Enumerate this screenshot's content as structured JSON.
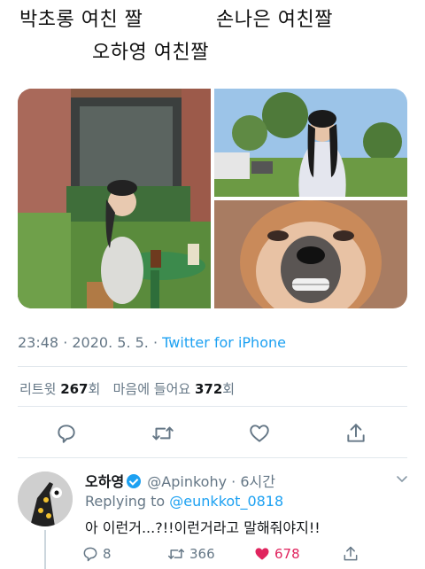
{
  "caption": {
    "line1": "박초롱 여친 짤",
    "line2": "손나은 여친짤",
    "line3": "오하영 여친짤"
  },
  "tweet": {
    "time": "23:48",
    "date": "2020. 5. 5.",
    "source": "Twitter for iPhone",
    "retweets_label": "리트윗",
    "retweets": "267",
    "retweets_unit": "회",
    "likes_label": "마음에 들어요",
    "likes": "372",
    "likes_unit": "회"
  },
  "reply": {
    "name": "오하영",
    "handle": "@Apinkohy",
    "time": "6시간",
    "replying_prefix": "Replying to",
    "replying_handle": "@eunkkot_0818",
    "text": "아 이런거...?!!이런거라고 말해줘야지!!",
    "reply_count": "8",
    "retweet_count": "366",
    "like_count": "678"
  },
  "colors": {
    "accent": "#1da1f2",
    "like": "#e0245e",
    "muted": "#657786"
  },
  "icons": [
    "reply-icon",
    "retweet-icon",
    "like-icon",
    "share-icon",
    "verified-icon",
    "chevron-down-icon"
  ]
}
